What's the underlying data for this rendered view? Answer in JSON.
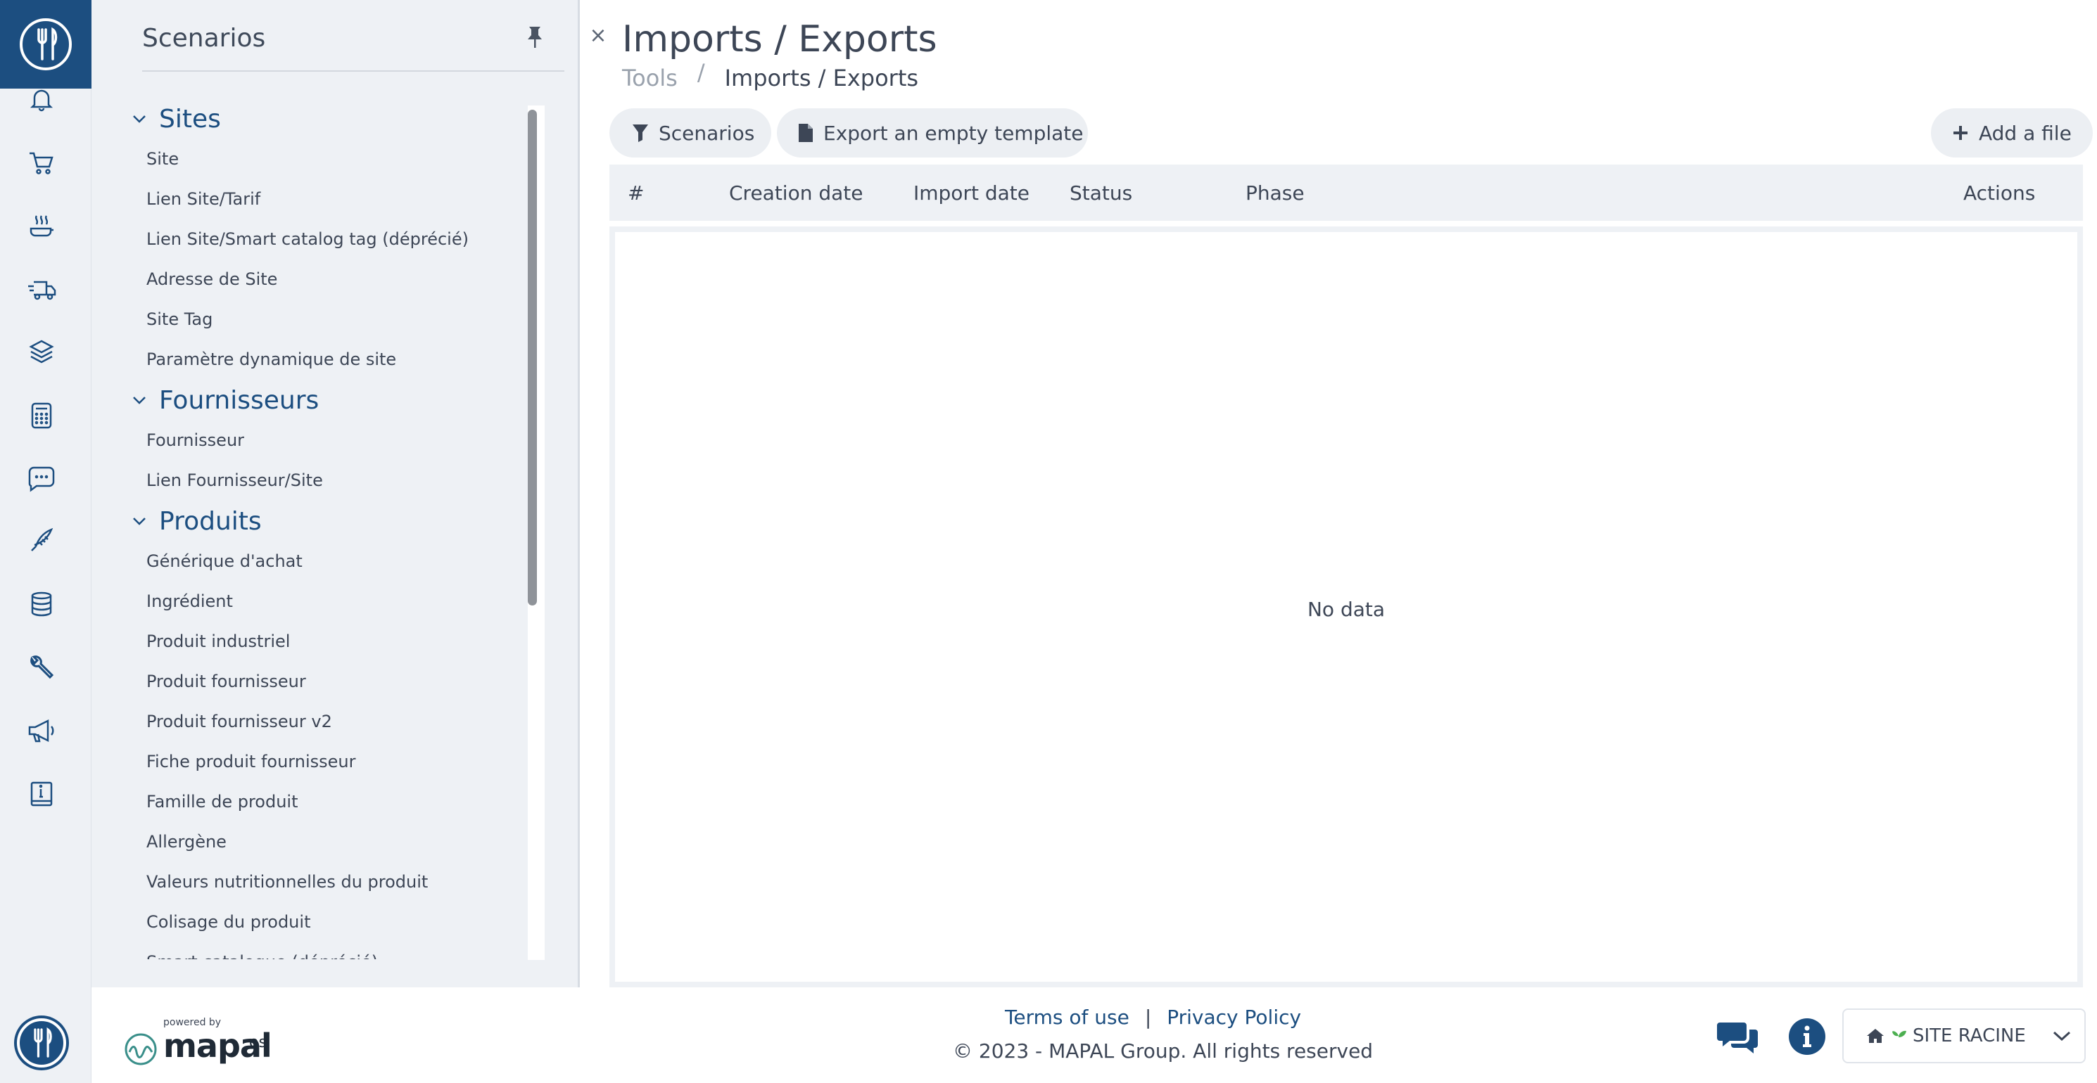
{
  "panel": {
    "title": "Scenarios",
    "groups": [
      {
        "label": "Sites",
        "items": [
          "Site",
          "Lien Site/Tarif",
          "Lien Site/Smart catalog tag (déprécié)",
          "Adresse de Site",
          "Site Tag",
          "Paramètre dynamique de site"
        ]
      },
      {
        "label": "Fournisseurs",
        "items": [
          "Fournisseur",
          "Lien Fournisseur/Site"
        ]
      },
      {
        "label": "Produits",
        "items": [
          "Générique d'achat",
          "Ingrédient",
          "Produit industriel",
          "Produit fournisseur",
          "Produit fournisseur v2",
          "Fiche produit fournisseur",
          "Famille de produit",
          "Allergène",
          "Valeurs nutritionnelles du produit",
          "Colisage du produit",
          "Smart catalogue (déprécié)"
        ]
      }
    ]
  },
  "page": {
    "title": "Imports / Exports",
    "breadcrumb": {
      "parent": "Tools",
      "separator": "/",
      "current": "Imports / Exports"
    }
  },
  "toolbar": {
    "scenarios_label": "Scenarios",
    "export_label": "Export an empty template",
    "add_label": "Add a file"
  },
  "table": {
    "columns": [
      "#",
      "Creation date",
      "Import date",
      "Status",
      "Phase",
      "Actions"
    ],
    "empty_text": "No data"
  },
  "footer": {
    "powered_by": "powered by",
    "brand": "mapal",
    "brand_suffix": "os",
    "terms": "Terms of use",
    "divider": "|",
    "privacy": "Privacy Policy",
    "copyright": "© 2023 - MAPAL Group. All rights reserved",
    "site_selector": "SITE RACINE"
  },
  "rail_icons": [
    "bell-icon",
    "cart-icon",
    "dish-icon",
    "truck-icon",
    "layers-icon",
    "calculator-icon",
    "chat-bubble-icon",
    "fish-icon",
    "database-icon",
    "wrench-icon",
    "megaphone-icon",
    "info-book-icon"
  ],
  "colors": {
    "brand": "#1c4e80",
    "rail_bg": "#eef1f5",
    "text": "#3d4656",
    "muted": "#9aa2ad"
  }
}
